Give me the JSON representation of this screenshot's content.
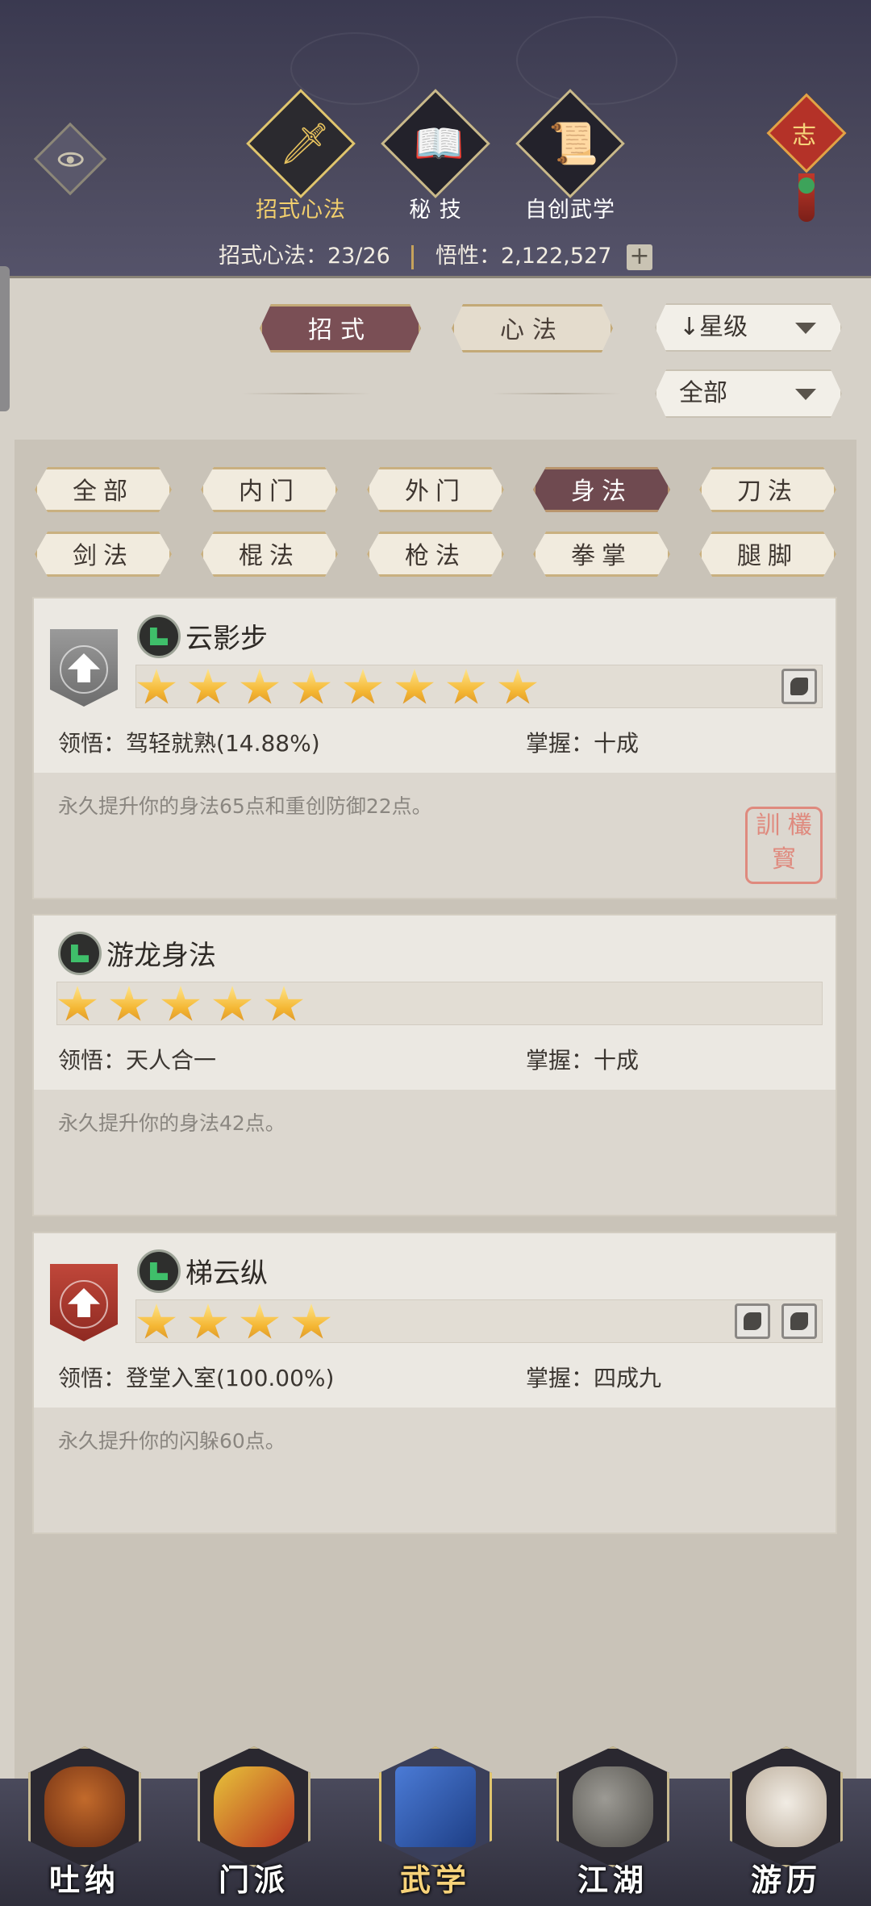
{
  "header": {
    "tabs": [
      {
        "label": "招式心法",
        "icon": "sword-icon",
        "active": true
      },
      {
        "label": "秘 技",
        "icon": "scroll-book-icon",
        "active": false
      },
      {
        "label": "自创武学",
        "icon": "rolled-scroll-icon",
        "active": false
      }
    ],
    "stat_label": "招式心法：",
    "stat_value": "23/26",
    "insight_label": "悟性：",
    "insight_value": "2,122,527",
    "plus": "+",
    "knot_char": "志"
  },
  "segments": {
    "moves": "招式",
    "mind": "心法",
    "sort": "↓星级",
    "filter": "全部"
  },
  "categories": [
    "全部",
    "内门",
    "外门",
    "身法",
    "刀法",
    "剑法",
    "棍法",
    "枪法",
    "拳掌",
    "腿脚"
  ],
  "active_category": "身法",
  "skills": [
    {
      "name": "云影步",
      "stars": 8,
      "insight_label": "领悟：",
      "insight_value": "驾轻就熟(14.88%)",
      "mastery_label": "掌握：",
      "mastery_value": "十成",
      "description": "永久提升你的身法65点和重创防御22点。",
      "badge": "silver-upgrade",
      "seal_text": "訓 欉 寳"
    },
    {
      "name": "游龙身法",
      "stars": 5,
      "insight_label": "领悟：",
      "insight_value": "天人合一",
      "mastery_label": "掌握：",
      "mastery_value": "十成",
      "description": "永久提升你的身法42点。"
    },
    {
      "name": "梯云纵",
      "stars": 4,
      "insight_label": "领悟：",
      "insight_value": "登堂入室(100.00%)",
      "mastery_label": "掌握：",
      "mastery_value": "四成九",
      "description": "永久提升你的闪躲60点。",
      "badge": "red-upgrade"
    }
  ],
  "bottom_nav": [
    {
      "label": "吐纳",
      "icon": "monk-icon",
      "active": false
    },
    {
      "label": "门派",
      "icon": "sect-banner-icon",
      "active": false
    },
    {
      "label": "武学",
      "icon": "manual-book-icon",
      "active": true
    },
    {
      "label": "江湖",
      "icon": "bamboo-hat-icon",
      "active": false
    },
    {
      "label": "游历",
      "icon": "horse-icon",
      "active": false
    }
  ],
  "colors": {
    "header_bg": "#3a3950",
    "active_tab": "#f2cf6d",
    "active_chip": "#6f4a50",
    "star": "#f4b632"
  }
}
